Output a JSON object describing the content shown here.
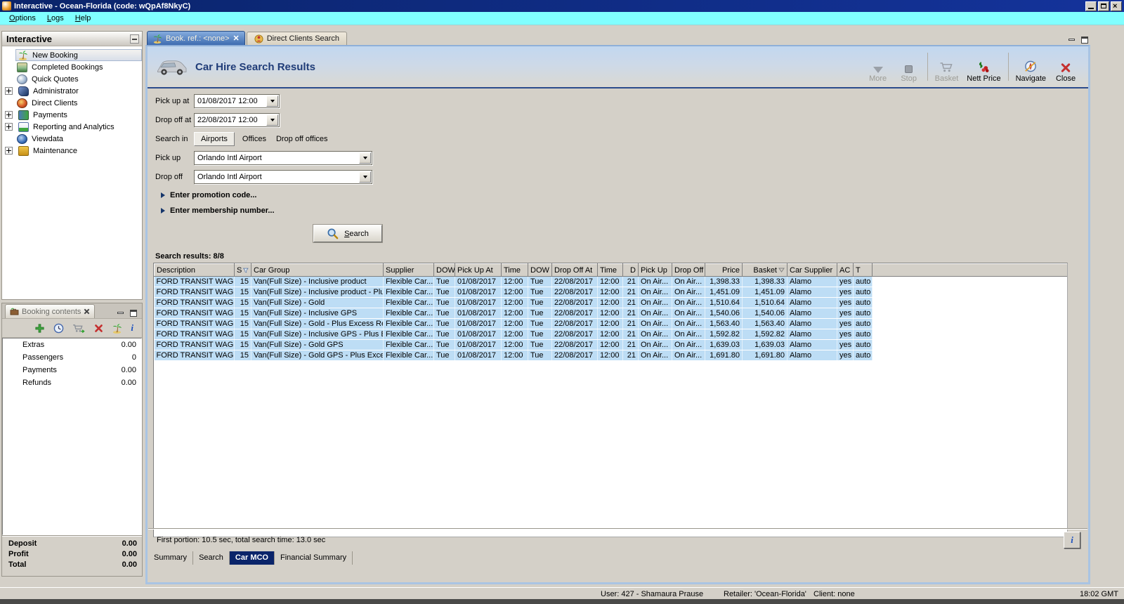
{
  "window": {
    "title": "Interactive - Ocean-Florida (code: wQpAf8NkyC)",
    "menu": {
      "options": "Options",
      "logs": "Logs",
      "help": "Help"
    }
  },
  "sidebar": {
    "title": "Interactive",
    "items": [
      {
        "label": "New Booking",
        "icon": "palm-tree"
      },
      {
        "label": "Completed Bookings",
        "icon": "money-palm"
      },
      {
        "label": "Quick Quotes",
        "icon": "stopwatch"
      },
      {
        "label": "Administrator",
        "icon": "admin-figure"
      },
      {
        "label": "Direct Clients",
        "icon": "globe-red"
      },
      {
        "label": "Payments",
        "icon": "banknote"
      },
      {
        "label": "Reporting and Analytics",
        "icon": "report-chart"
      },
      {
        "label": "Viewdata",
        "icon": "globe-blue"
      },
      {
        "label": "Maintenance",
        "icon": "toolbox"
      }
    ]
  },
  "tabs": {
    "booking": "Book. ref.: <none>",
    "direct_clients": "Direct Clients Search"
  },
  "header": {
    "title": "Car Hire Search Results",
    "more": "More",
    "stop": "Stop",
    "basket": "Basket",
    "nett_price": "Nett Price",
    "navigate": "Navigate",
    "close": "Close"
  },
  "form": {
    "pickup_at_label": "Pick up at",
    "pickup_at_value": "01/08/2017 12:00",
    "dropoff_at_label": "Drop off at",
    "dropoff_at_value": "22/08/2017 12:00",
    "search_in_label": "Search in",
    "search_in_tabs": {
      "airports": "Airports",
      "offices": "Offices",
      "dropoff_offices": "Drop off offices"
    },
    "pickup_label": "Pick up",
    "pickup_value": "Orlando Intl Airport",
    "dropoff_label": "Drop off",
    "dropoff_value": "Orlando Intl Airport",
    "promo_expander": "Enter promotion code...",
    "membership_expander": "Enter membership number...",
    "search_button": "Search"
  },
  "results": {
    "summary": "Search results: 8/8",
    "columns": [
      "Description",
      "S",
      "Car Group",
      "Supplier",
      "DOW",
      "Pick Up At",
      "Time",
      "DOW",
      "Drop Off At",
      "Time",
      "D",
      "Pick Up",
      "Drop Off",
      "Price",
      "Basket",
      "Car Supplier",
      "AC",
      "T"
    ],
    "rows": [
      [
        "FORD TRANSIT WAG...",
        "15",
        "Van(Full Size) - Inclusive product",
        "Flexible Car...",
        "Tue",
        "01/08/2017",
        "12:00",
        "Tue",
        "22/08/2017",
        "12:00",
        "21",
        "On Air...",
        "On Air...",
        "1,398.33",
        "1,398.33",
        "Alamo",
        "yes",
        "auto"
      ],
      [
        "FORD TRANSIT WAG...",
        "15",
        "Van(Full Size) - Inclusive product - Plu...",
        "Flexible Car...",
        "Tue",
        "01/08/2017",
        "12:00",
        "Tue",
        "22/08/2017",
        "12:00",
        "21",
        "On Air...",
        "On Air...",
        "1,451.09",
        "1,451.09",
        "Alamo",
        "yes",
        "auto"
      ],
      [
        "FORD TRANSIT WAG...",
        "15",
        "Van(Full Size) - Gold",
        "Flexible Car...",
        "Tue",
        "01/08/2017",
        "12:00",
        "Tue",
        "22/08/2017",
        "12:00",
        "21",
        "On Air...",
        "On Air...",
        "1,510.64",
        "1,510.64",
        "Alamo",
        "yes",
        "auto"
      ],
      [
        "FORD TRANSIT WAG...",
        "15",
        "Van(Full Size) - Inclusive GPS",
        "Flexible Car...",
        "Tue",
        "01/08/2017",
        "12:00",
        "Tue",
        "22/08/2017",
        "12:00",
        "21",
        "On Air...",
        "On Air...",
        "1,540.06",
        "1,540.06",
        "Alamo",
        "yes",
        "auto"
      ],
      [
        "FORD TRANSIT WAG...",
        "15",
        "Van(Full Size) - Gold - Plus Excess Ref...",
        "Flexible Car...",
        "Tue",
        "01/08/2017",
        "12:00",
        "Tue",
        "22/08/2017",
        "12:00",
        "21",
        "On Air...",
        "On Air...",
        "1,563.40",
        "1,563.40",
        "Alamo",
        "yes",
        "auto"
      ],
      [
        "FORD TRANSIT WAG...",
        "15",
        "Van(Full Size) - Inclusive GPS - Plus Ex...",
        "Flexible Car...",
        "Tue",
        "01/08/2017",
        "12:00",
        "Tue",
        "22/08/2017",
        "12:00",
        "21",
        "On Air...",
        "On Air...",
        "1,592.82",
        "1,592.82",
        "Alamo",
        "yes",
        "auto"
      ],
      [
        "FORD TRANSIT WAG...",
        "15",
        "Van(Full Size) - Gold GPS",
        "Flexible Car...",
        "Tue",
        "01/08/2017",
        "12:00",
        "Tue",
        "22/08/2017",
        "12:00",
        "21",
        "On Air...",
        "On Air...",
        "1,639.03",
        "1,639.03",
        "Alamo",
        "yes",
        "auto"
      ],
      [
        "FORD TRANSIT WAG...",
        "15",
        "Van(Full Size) - Gold GPS - Plus Excess...",
        "Flexible Car...",
        "Tue",
        "01/08/2017",
        "12:00",
        "Tue",
        "22/08/2017",
        "12:00",
        "21",
        "On Air...",
        "On Air...",
        "1,691.80",
        "1,691.80",
        "Alamo",
        "yes",
        "auto"
      ]
    ]
  },
  "panel_status": {
    "text": "First portion: 10.5 sec, total search time: 13.0 sec",
    "info_button": "i"
  },
  "bottom_tabs": {
    "summary": "Summary",
    "search": "Search",
    "car_mco": "Car MCO",
    "financial": "Financial Summary"
  },
  "booking_contents": {
    "title": "Booking contents",
    "rows": [
      {
        "label": "Extras",
        "value": "0.00"
      },
      {
        "label": "Passengers",
        "value": "0"
      },
      {
        "label": "Payments",
        "value": "0.00"
      },
      {
        "label": "Refunds",
        "value": "0.00"
      }
    ],
    "totals": [
      {
        "label": "Deposit",
        "value": "0.00"
      },
      {
        "label": "Profit",
        "value": "0.00"
      },
      {
        "label": "Total",
        "value": "0.00"
      }
    ],
    "info_button": "i"
  },
  "app_status": {
    "user": "User: 427 - Shamaura Prause",
    "retailer": "Retailer: 'Ocean-Florida'",
    "client": "Client: none",
    "time": "18:02 GMT"
  },
  "colors": {
    "titlebar": "#0A246A",
    "menubar": "#80FFFF",
    "row_highlight": "#BDDDF5",
    "active_bottom_tab": "#0A246A"
  }
}
